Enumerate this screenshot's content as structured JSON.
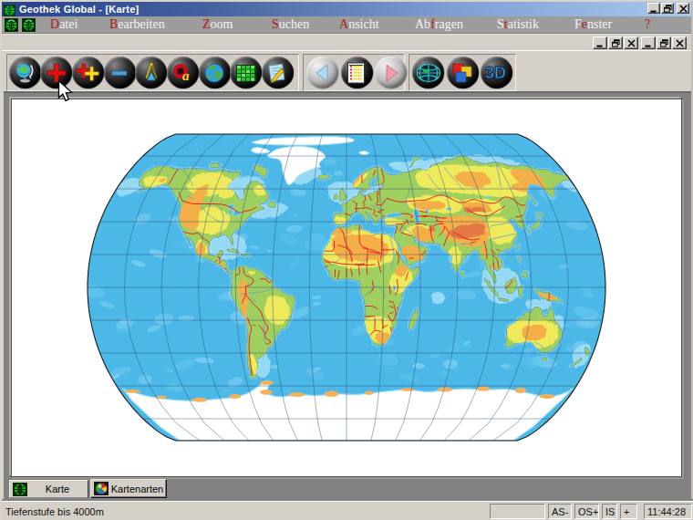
{
  "window": {
    "title": "Geothek Global - [Karte]",
    "app_icon": "globe-icon"
  },
  "menu": {
    "items": [
      {
        "text": "Datei",
        "hot": 0
      },
      {
        "text": "Bearbeiten",
        "hot": 0
      },
      {
        "text": "Zoom",
        "hot": 0
      },
      {
        "text": "Suchen",
        "hot": 0
      },
      {
        "text": "Ansicht",
        "hot": 0
      },
      {
        "text": "Abfragen",
        "hot": 2
      },
      {
        "text": "Statistik",
        "hot": 1
      },
      {
        "text": "Fenster",
        "hot": 1
      },
      {
        "text": "?",
        "hot": 0
      }
    ]
  },
  "toolbar": {
    "buttons_group1": [
      "desk-globe",
      "zoom-in",
      "zoom-in-strong",
      "zoom-out",
      "measure-compass",
      "find-name",
      "earth",
      "data-table",
      "edit-notes"
    ],
    "buttons_group2": [
      "back",
      "statistics-table",
      "forward"
    ],
    "buttons_group3": [
      "globe-grid",
      "map-layers",
      "view-3d"
    ],
    "button_3d_label": "3D",
    "find_name_glyph": "a"
  },
  "tabs": [
    {
      "label": "Karte",
      "icon": "globe-grid-icon",
      "active": true
    },
    {
      "label": "Kartenarten",
      "icon": "map-types-icon",
      "active": false
    }
  ],
  "statusbar": {
    "message": "Tiefenstufe bis 4000m",
    "panels": [
      "",
      "AS-",
      "OS+",
      "IS",
      "+"
    ],
    "clock": "11:44:28"
  },
  "colors": {
    "titlebar_left": "#27418c",
    "titlebar_right": "#aac8ee",
    "menubar": "#9c9c9c",
    "menu_hotkey": "#b41616",
    "chrome": "#d4d0c8",
    "frame_gray": "#828282",
    "ocean": "#2aabe4",
    "land_low": "#8dc63f",
    "land_mid": "#ece63d",
    "land_high": "#f2a028",
    "border_red": "#ee1018"
  }
}
